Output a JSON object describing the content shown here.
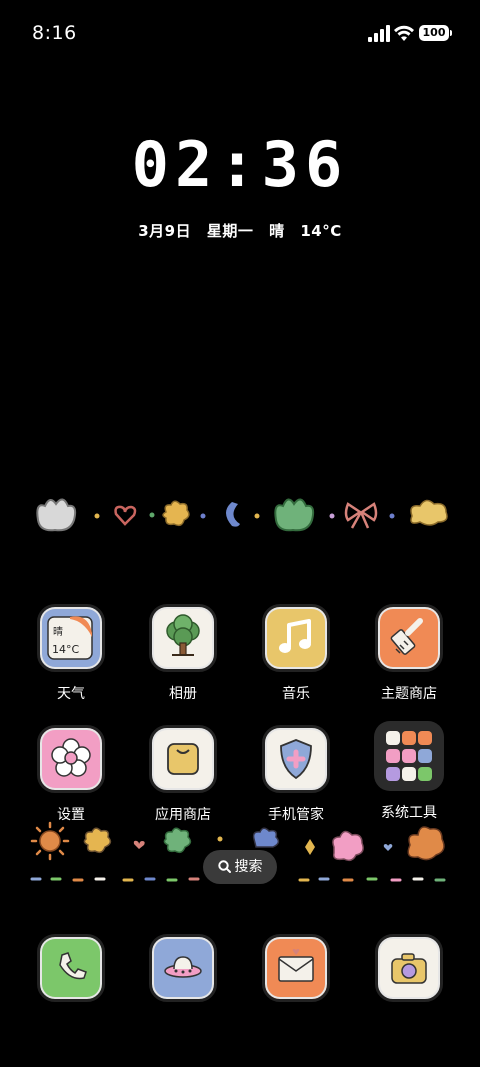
{
  "status_bar": {
    "time": "8:16",
    "battery": "100"
  },
  "lockclock": {
    "time": "02:36",
    "date": "3月9日",
    "weekday": "星期一",
    "weather": "晴",
    "temperature": "14°C"
  },
  "weather_icon": {
    "condition": "晴",
    "temp": "14°C"
  },
  "apps": {
    "row1": [
      {
        "label": "天气",
        "icon": "weather-icon",
        "color": "#8fa8d8"
      },
      {
        "label": "相册",
        "icon": "tree-photo-icon",
        "color": "#f4f1ea"
      },
      {
        "label": "音乐",
        "icon": "music-note-icon",
        "color": "#e8c66a"
      },
      {
        "label": "主题商店",
        "icon": "brush-icon",
        "color": "#f08a55"
      }
    ],
    "row2": [
      {
        "label": "设置",
        "icon": "flower-gear-icon",
        "color": "#f29ec4"
      },
      {
        "label": "应用商店",
        "icon": "bag-icon",
        "color": "#f4f1ea"
      },
      {
        "label": "手机管家",
        "icon": "shield-icon",
        "color": "#f4f1ea"
      },
      {
        "label": "系统工具",
        "icon": "folder-icon",
        "color": "#2b2b2b"
      }
    ],
    "dock": [
      {
        "icon": "phone-icon",
        "color": "#7cc76a"
      },
      {
        "icon": "ufo-icon",
        "color": "#8fa8d8"
      },
      {
        "icon": "envelope-icon",
        "color": "#f08a55"
      },
      {
        "icon": "camera-icon",
        "color": "#f4f1ea"
      }
    ]
  },
  "search": {
    "label": "搜索"
  }
}
